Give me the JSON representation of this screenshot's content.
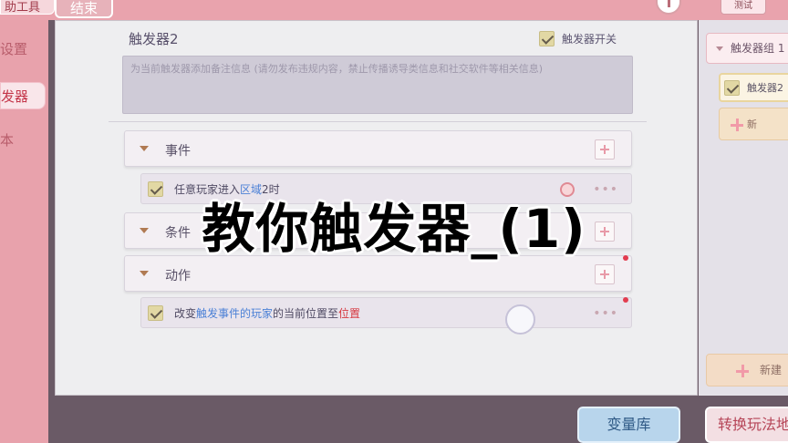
{
  "topbar": {
    "left_tab_label": "助工具",
    "end_button_label": "结束",
    "test_button_label": "测试"
  },
  "sidebar": {
    "items": [
      {
        "label": "设置"
      },
      {
        "label": "发器"
      },
      {
        "label": "本"
      }
    ]
  },
  "editor": {
    "trigger_title": "触发器2",
    "switch_label": "触发器开关",
    "note_placeholder": "为当前触发器添加备注信息 (请勿发布违规内容，禁止传播诱导类信息和社交软件等相关信息)",
    "sections": {
      "events": {
        "label": "事件",
        "row": {
          "prefix": "任意玩家进入",
          "link": "区域",
          "suffix": "2时"
        }
      },
      "conditions": {
        "label": "条件"
      },
      "actions": {
        "label": "动作",
        "row": {
          "prefix": "改变",
          "link": "触发事件的玩家",
          "middle": "的当前位置至",
          "target": "位置"
        }
      }
    },
    "more_glyph": "•••"
  },
  "right_panel": {
    "group_label": "触发器组 1",
    "trigger_item_label": "触发器2",
    "new_item_label": "新",
    "new_bottom_label": "新建"
  },
  "bottom": {
    "vars_button_label": "变量库",
    "switch_mode_label": "转换玩法地"
  },
  "overlay": {
    "caption": "教你触发器_(1)"
  },
  "colors": {
    "accent_pink": "#e8a2ac",
    "link_blue": "#4b80d6",
    "target_red": "#d6373f"
  }
}
